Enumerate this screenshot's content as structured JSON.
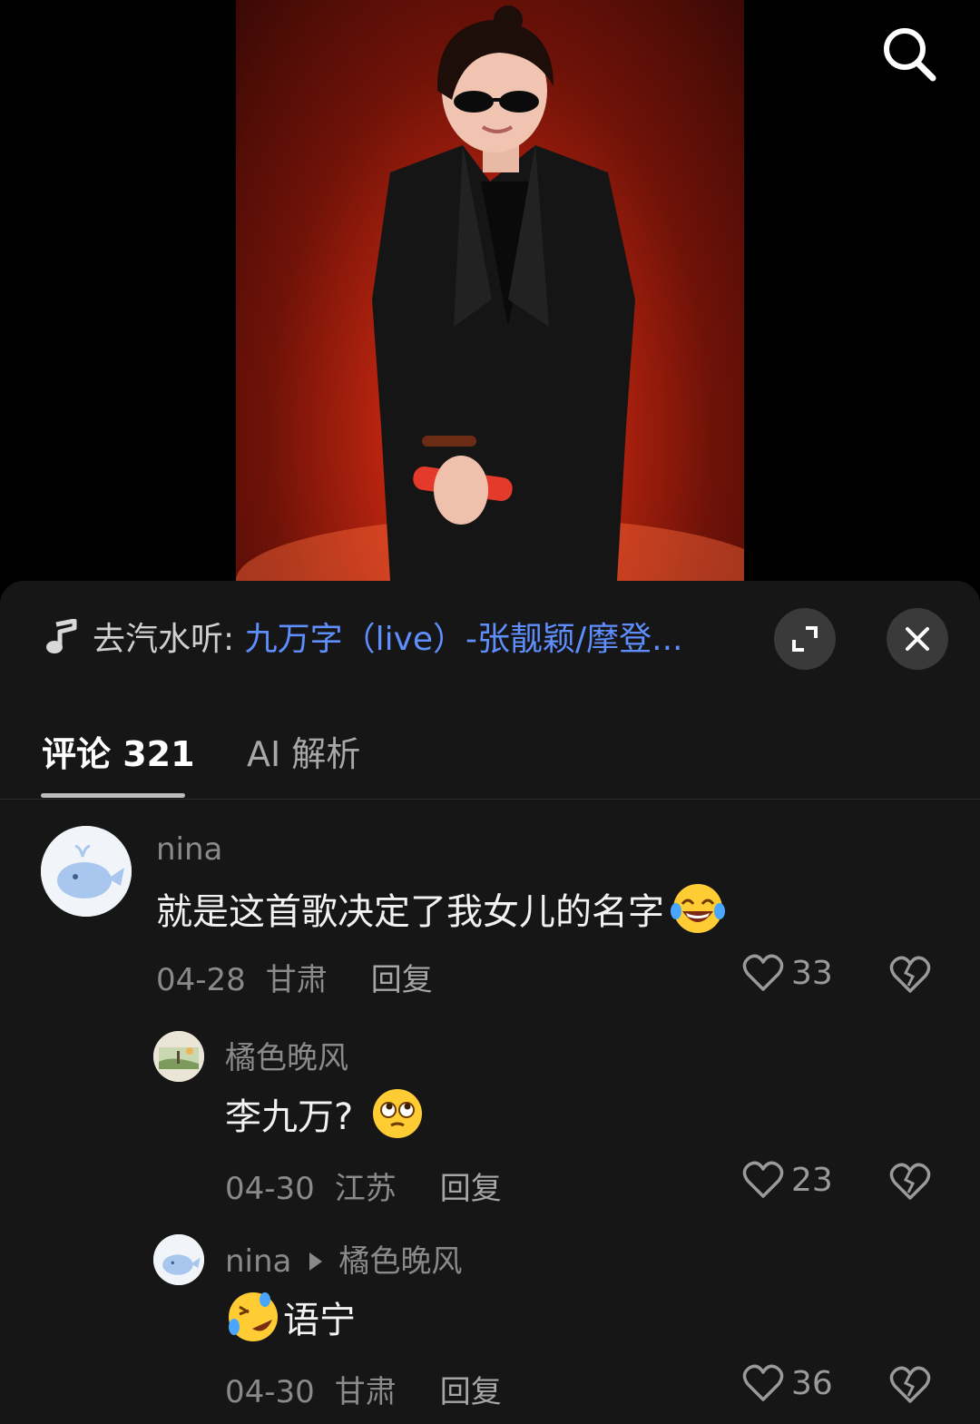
{
  "music": {
    "prefix": "去汽水听: ",
    "title": "九万字（live）-张靓颖/摩登..."
  },
  "tabs": {
    "comments_label": "评论 321",
    "ai_label": "AI 解析"
  },
  "comments": [
    {
      "author": "nina",
      "text": "就是这首歌决定了我女儿的名字",
      "date": "04-28",
      "location": "甘肃",
      "reply_label": "回复",
      "likes": "33"
    },
    {
      "author": "橘色晚风",
      "text": "李九万?",
      "date": "04-30",
      "location": "江苏",
      "reply_label": "回复",
      "likes": "23"
    },
    {
      "author": "nina",
      "reply_to": "橘色晚风",
      "text": "语宁",
      "date": "04-30",
      "location": "甘肃",
      "reply_label": "回复",
      "likes": "36"
    }
  ],
  "colors": {
    "link": "#5f8fff",
    "sheet_bg": "#161616",
    "muted_text": "#8a8a8a"
  }
}
